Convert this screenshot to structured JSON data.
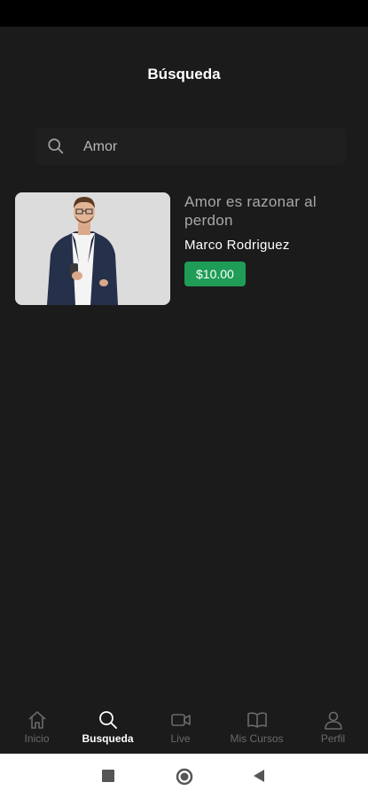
{
  "header": {
    "title": "Búsqueda"
  },
  "search": {
    "value": "Amor",
    "icon": "search-icon"
  },
  "results": [
    {
      "title": "Amor es razonar al perdon",
      "instructor": "Marco Rodriguez",
      "price": "$10.00"
    }
  ],
  "bottom_nav": {
    "items": [
      {
        "label": "Inicio",
        "icon": "home-icon",
        "active": false
      },
      {
        "label": "Busqueda",
        "icon": "search-icon",
        "active": true
      },
      {
        "label": "Live",
        "icon": "video-camera-icon",
        "active": false
      },
      {
        "label": "Mis Cursos",
        "icon": "open-book-icon",
        "active": false
      },
      {
        "label": "Perfil",
        "icon": "user-icon",
        "active": false
      }
    ]
  },
  "colors": {
    "background": "#1b1b1b",
    "price_badge": "#1f9d57",
    "nav_inactive": "#6a6a6a",
    "nav_active": "#ffffff"
  }
}
